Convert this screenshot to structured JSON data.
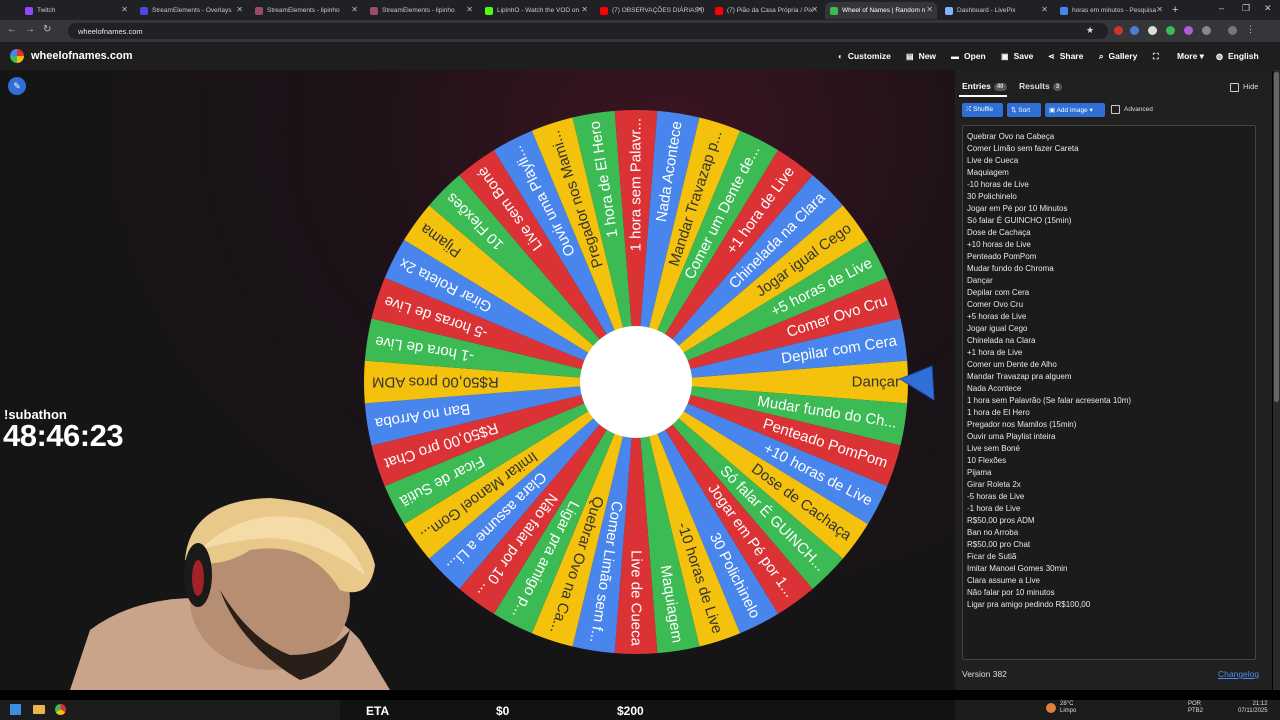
{
  "browser": {
    "tabs": [
      {
        "title": "Twitch",
        "color": "#9146ff"
      },
      {
        "title": "StreamElements - Overlays",
        "color": "#4a4ad9"
      },
      {
        "title": "StreamElements - lipinho",
        "color": "#9b4a6b"
      },
      {
        "title": "StreamElements - lipinho",
        "color": "#9b4a6b"
      },
      {
        "title": "LipinhO - Watch the VOD on",
        "color": "#53fc18"
      },
      {
        "title": "(7) OBSERVAÇÕES DIÁRIAS (I",
        "color": "#ff0000"
      },
      {
        "title": "(7) Pião da Casa Própria / Pix",
        "color": "#ff0000"
      },
      {
        "title": "Wheel of Names | Random n",
        "color": "#3cba54"
      },
      {
        "title": "Dashboard - LivePix",
        "color": "#7fb3ff"
      },
      {
        "title": "horas em minutos - Pesquisa",
        "color": "#4885ed"
      }
    ],
    "url": "wheelofnames.com"
  },
  "site": {
    "name": "wheelofnames.com",
    "menu": [
      {
        "label": "Customize",
        "icon": "palette-icon"
      },
      {
        "label": "New",
        "icon": "new-file-icon"
      },
      {
        "label": "Open",
        "icon": "folder-icon"
      },
      {
        "label": "Save",
        "icon": "save-icon"
      },
      {
        "label": "Share",
        "icon": "share-icon"
      },
      {
        "label": "Gallery",
        "icon": "search-icon"
      },
      {
        "label": "",
        "icon": "fullscreen-icon"
      },
      {
        "label": "More",
        "icon": "chevron-down-icon"
      },
      {
        "label": "English",
        "icon": "globe-icon"
      }
    ]
  },
  "panel": {
    "entries_label": "Entries",
    "entries_count": "40",
    "results_label": "Results",
    "results_count": "3",
    "hide_label": "Hide",
    "shuffle_label": "Shuffle",
    "sort_label": "Sort",
    "add_image_label": "Add image",
    "advanced_label": "Advanced",
    "entries": [
      "Quebrar Ovo na Cabeça",
      "Comer Limão sem fazer Careta",
      "Live de Cueca",
      "Maquiagem",
      "-10 horas de Live",
      "30 Polichinelo",
      "Jogar em Pé por 10 Minutos",
      "Só falar É GUINCHO (15min)",
      "Dose de Cachaça",
      "+10 horas de Live",
      "Penteado PomPom",
      "Mudar fundo do Chroma",
      "Dançar",
      "Depilar com Cera",
      "Comer Ovo Cru",
      "+5 horas de Live",
      "Jogar igual Cego",
      "Chinelada na Clara",
      "+1 hora de Live",
      "Comer um Dente de Alho",
      "Mandar Travazap pra alguem",
      "Nada Acontece",
      "1 hora sem Palavrão (Se falar acresenta 10m)",
      "1 hora de El Hero",
      "Pregador nos Mamilos (15min)",
      "Ouvir uma Playlist inteira",
      "Live sem Boné",
      "10 Flexões",
      "Pijama",
      "Girar Roleta 2x",
      "-5 horas de Live",
      "-1 hora de Live",
      "R$50,00 pros ADM",
      "Ban no Arroba",
      "R$50,00 pro Chat",
      "Ficar de Sutiã",
      "Imitar Manoel Gomes 30min",
      "Clara assume a Live",
      "Não falar por 10 minutos",
      "Ligar pra amigo pedindo R$100,00"
    ],
    "version": "Version 382",
    "changelog": "Changelog"
  },
  "wheel": {
    "colors": [
      "#f4c20d",
      "#3cba54",
      "#db3236",
      "#4885ed"
    ],
    "labels": [
      "Dançar",
      "Mudar fundo do Ch...",
      "Penteado PomPom",
      "+10 horas de Live",
      "Dose de Cachaça",
      "Só falar É GUINCH...",
      "Jogar em Pé por 1...",
      "30 Polichinelo",
      "-10 horas de Live",
      "Maquiagem",
      "Live de Cueca",
      "Comer Limão sem f...",
      "Quebrar Ovo na Ca...",
      "Ligar pra amigo p...",
      "Não falar por 10 ...",
      "Clara assume a Li...",
      "Imitar Manoel Gom...",
      "Ficar de Sutiã",
      "R$50,00 pro Chat",
      "Ban no Arroba",
      "R$50,00 pros ADM",
      "-1 hora de Live",
      "-5 horas de Live",
      "Girar Roleta 2x",
      "Pijama",
      "10 Flexões",
      "Live sem Boné",
      "Ouvir uma Playli...",
      "Pregador nos Mami...",
      "1 hora de El Hero",
      "1 hora sem Palavr...",
      "Nada Acontece",
      "Mandar Travazap p...",
      "Comer um Dente de...",
      "+1 hora de Live",
      "Chinelada na Clara",
      "Jogar igual Cego",
      "+5 horas de Live",
      "Comer Ovo Cru",
      "Depilar com Cera"
    ]
  },
  "overlay": {
    "subathon_tag": "!subathon",
    "timer": "48:46:23",
    "eta": "ETA",
    "amount_left": "$0",
    "amount_right": "$200"
  },
  "taskbar": {
    "temp": "28°C",
    "weather": "Limpo",
    "lang1": "POR",
    "lang2": "PTB2",
    "time": "21:12",
    "date": "07/11/2025"
  }
}
